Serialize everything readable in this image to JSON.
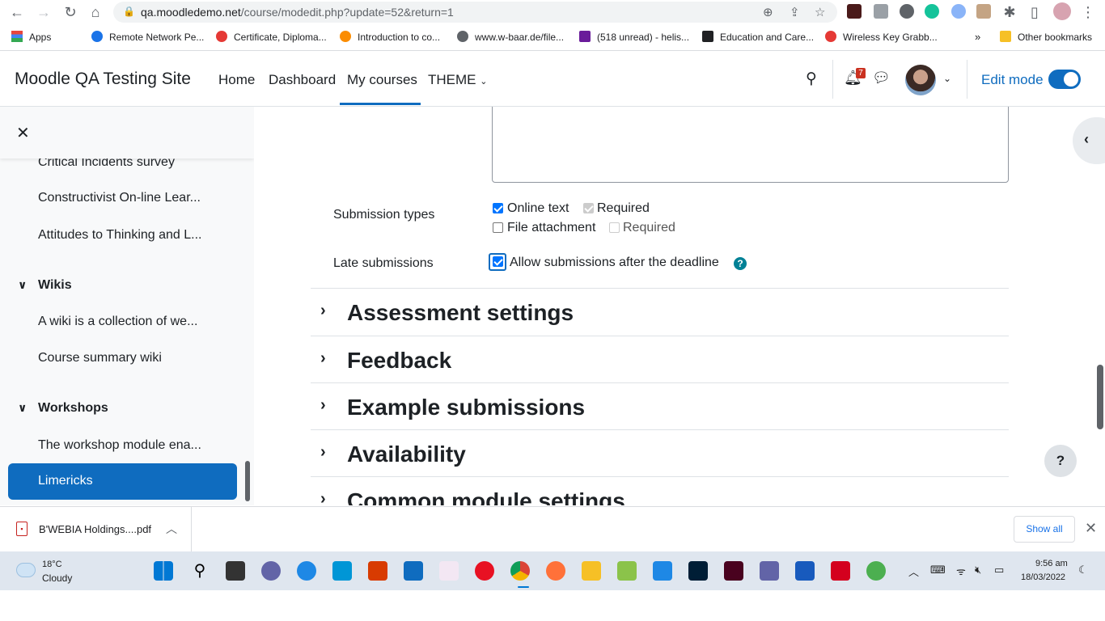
{
  "browser": {
    "url_host": "qa.moodledemo.net",
    "url_path": "/course/modedit.php?update=52&return=1",
    "bookmarks": [
      {
        "label": "Apps",
        "color": "#e8453c"
      },
      {
        "label": "Remote Network Pe...",
        "color": "#1a73e8"
      },
      {
        "label": "Certificate, Diploma...",
        "color": "#e53935"
      },
      {
        "label": "Introduction to co...",
        "color": "#fb8c00"
      },
      {
        "label": "www.w-baar.de/file...",
        "color": "#5f6368"
      },
      {
        "label": "(518 unread) - helis...",
        "color": "#6a1b9a"
      },
      {
        "label": "Education and Care...",
        "color": "#202124"
      },
      {
        "label": "Wireless Key Grabb...",
        "color": "#e53935"
      },
      {
        "label": "Other bookmarks",
        "color": "#f6c026"
      }
    ],
    "bookmarks_overflow": "»"
  },
  "navbar": {
    "site_name": "Moodle QA Testing Site",
    "links": [
      "Home",
      "Dashboard",
      "My courses",
      "THEME"
    ],
    "notification_count": "7",
    "edit_mode_label": "Edit mode"
  },
  "drawer": {
    "items": [
      {
        "label": "Critical Incidents survey",
        "type": "item"
      },
      {
        "label": "Constructivist On-line Lear...",
        "type": "item"
      },
      {
        "label": "Attitudes to Thinking and L...",
        "type": "item"
      },
      {
        "label": "Wikis",
        "type": "section"
      },
      {
        "label": "A wiki is a collection of we...",
        "type": "item"
      },
      {
        "label": "Course summary wiki",
        "type": "item"
      },
      {
        "label": "Workshops",
        "type": "section"
      },
      {
        "label": "The workshop module ena...",
        "type": "item"
      }
    ],
    "active_item": "Limericks"
  },
  "form": {
    "submission_types_label": "Submission types",
    "online_text_label": "Online text",
    "online_text_required_label": "Required",
    "file_attachment_label": "File attachment",
    "file_attachment_required_label": "Required",
    "late_submissions_label": "Late submissions",
    "late_submissions_option": "Allow submissions after the deadline",
    "help_glyph": "?"
  },
  "sections": [
    "Assessment settings",
    "Feedback",
    "Example submissions",
    "Availability",
    "Common module settings"
  ],
  "help_fab": "?",
  "downloads": {
    "file_name": "B'WEBIA Holdings....pdf",
    "show_all": "Show all"
  },
  "taskbar": {
    "weather_temp": "18°C",
    "weather_desc": "Cloudy",
    "time": "9:56 am",
    "date": "18/03/2022"
  }
}
